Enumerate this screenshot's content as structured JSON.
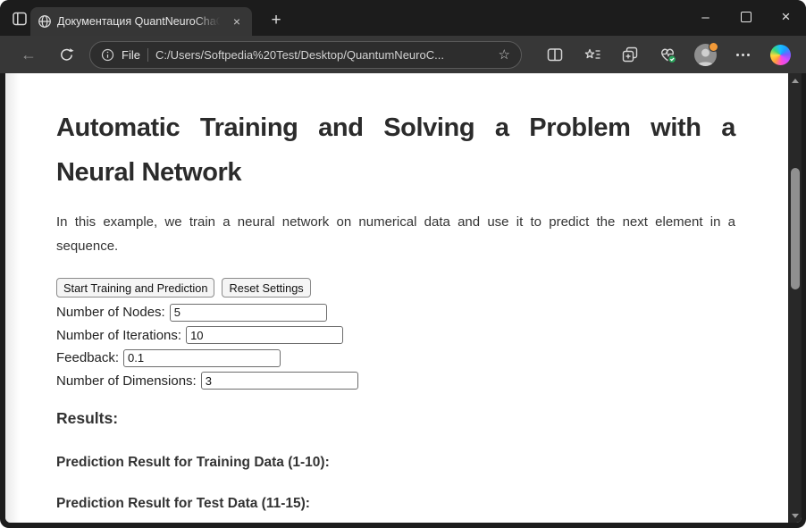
{
  "icons": {
    "minimize": "–",
    "close": "×",
    "tab_close": "×",
    "new_tab": "+",
    "back": "←",
    "favorite_star": "☆"
  },
  "colors": {
    "chrome_dark": "#1c1c1c",
    "toolbar": "#373737",
    "essentials_badge_green": "#2aa45c",
    "avatar_badge_orange": "#f29a38",
    "scroll_thumb": "#909090"
  },
  "browser": {
    "tab_title": "Документация QuantNeuroChaC",
    "omnibox": {
      "scheme": "File",
      "url": "C:/Users/Softpedia%20Test/Desktop/QuantumNeuroC..."
    }
  },
  "page": {
    "title_line1": "Automatic Training and Solving a Problem with a",
    "title_line2": "Neural Network",
    "intro_line1": "In this example, we train a neural network on numerical data and use it to predict the next element in a",
    "intro_line2": "sequence.",
    "start_button": "Start Training and Prediction",
    "reset_button": "Reset Settings",
    "fields": [
      {
        "label": "Number of Nodes:",
        "value": "5"
      },
      {
        "label": "Number of Iterations:",
        "value": "10"
      },
      {
        "label": "Feedback:",
        "value": "0.1"
      },
      {
        "label": "Number of Dimensions:",
        "value": "3"
      }
    ],
    "results_heading": "Results:",
    "training_result_heading": "Prediction Result for Training Data (1-10):",
    "test_result_heading": "Prediction Result for Test Data (11-15):"
  }
}
